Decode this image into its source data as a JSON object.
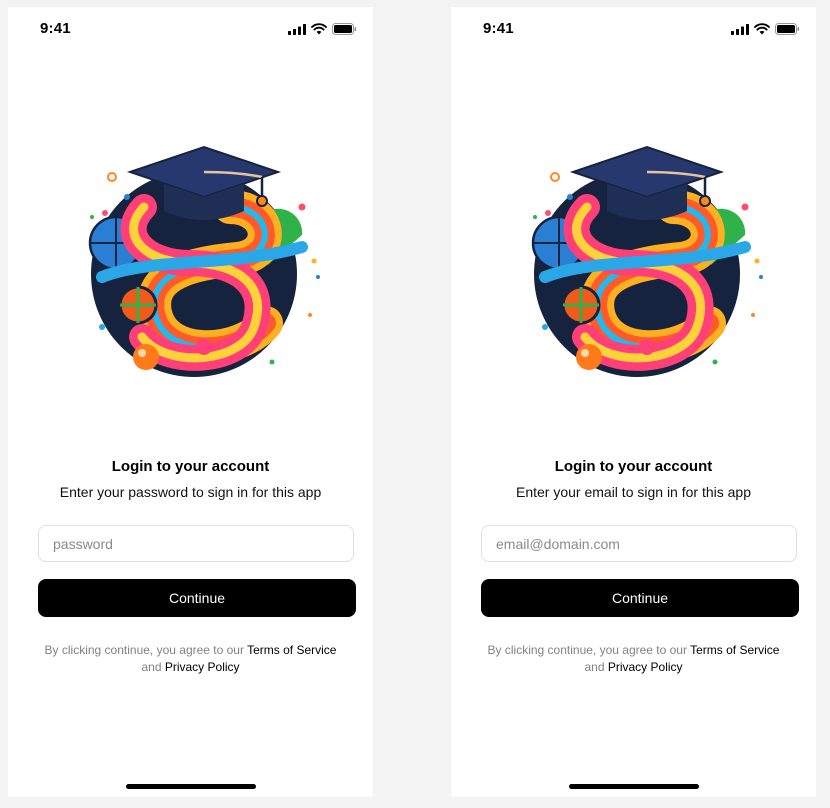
{
  "screens": [
    {
      "status_time": "9:41",
      "title": "Login to your account",
      "subtitle": "Enter your password to sign in for this app",
      "input": {
        "value": "",
        "placeholder": "password"
      },
      "button_label": "Continue",
      "legal": {
        "prefix": "By clicking continue, you agree to our",
        "terms_link": "Terms of Service",
        "and": "and",
        "privacy_link": "Privacy Policy"
      }
    },
    {
      "status_time": "9:41",
      "title": "Login to your account",
      "subtitle": "Enter your email to sign in for this app",
      "input": {
        "value": "",
        "placeholder": "email@domain.com"
      },
      "button_label": "Continue",
      "legal": {
        "prefix": "By clicking continue, you agree to our",
        "terms_link": "Terms of Service",
        "and": "and",
        "privacy_link": "Privacy Policy"
      }
    }
  ],
  "icons": [
    "cellular-signal-icon",
    "wifi-icon",
    "battery-icon"
  ],
  "colors": {
    "background": "#f3f3f3",
    "screen": "#ffffff",
    "primary_button": "#000000",
    "muted_text": "#828282"
  }
}
